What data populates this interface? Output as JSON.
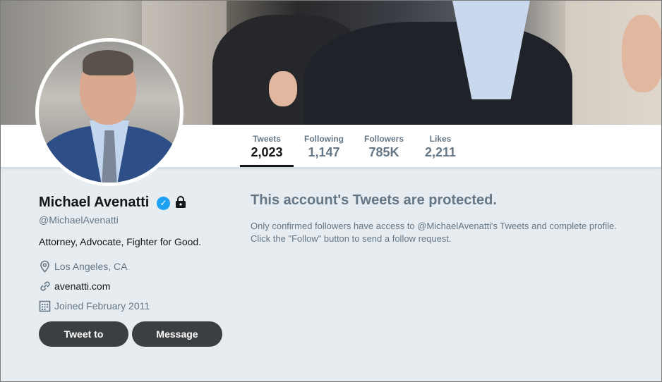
{
  "profile": {
    "name": "Michael Avenatti",
    "handle": "@MichaelAvenatti",
    "bio": "Attorney, Advocate, Fighter for Good.",
    "location": "Los Angeles, CA",
    "website": "avenatti.com",
    "joined": "Joined February 2011",
    "verified": true,
    "protected": true
  },
  "nav": {
    "items": [
      {
        "label": "Tweets",
        "value": "2,023",
        "active": true
      },
      {
        "label": "Following",
        "value": "1,147",
        "active": false
      },
      {
        "label": "Followers",
        "value": "785K",
        "active": false
      },
      {
        "label": "Likes",
        "value": "2,211",
        "active": false
      }
    ]
  },
  "actions": {
    "tweet_to_label": "Tweet to",
    "message_label": "Message"
  },
  "protected_notice": {
    "title": "This account's Tweets are protected.",
    "line1": "Only confirmed followers have access to @MichaelAvenatti's Tweets and complete profile.",
    "line2": "Click the \"Follow\" button to send a follow request."
  },
  "icons": {
    "verified": "verified-badge-icon",
    "lock": "lock-icon",
    "location": "location-pin-icon",
    "link": "link-icon",
    "calendar": "calendar-icon"
  },
  "colors": {
    "accent": "#1da1f2",
    "text_primary": "#14171a",
    "text_secondary": "#657786",
    "page_bg": "#e6ecf0",
    "button_bg": "#3c3f42"
  }
}
